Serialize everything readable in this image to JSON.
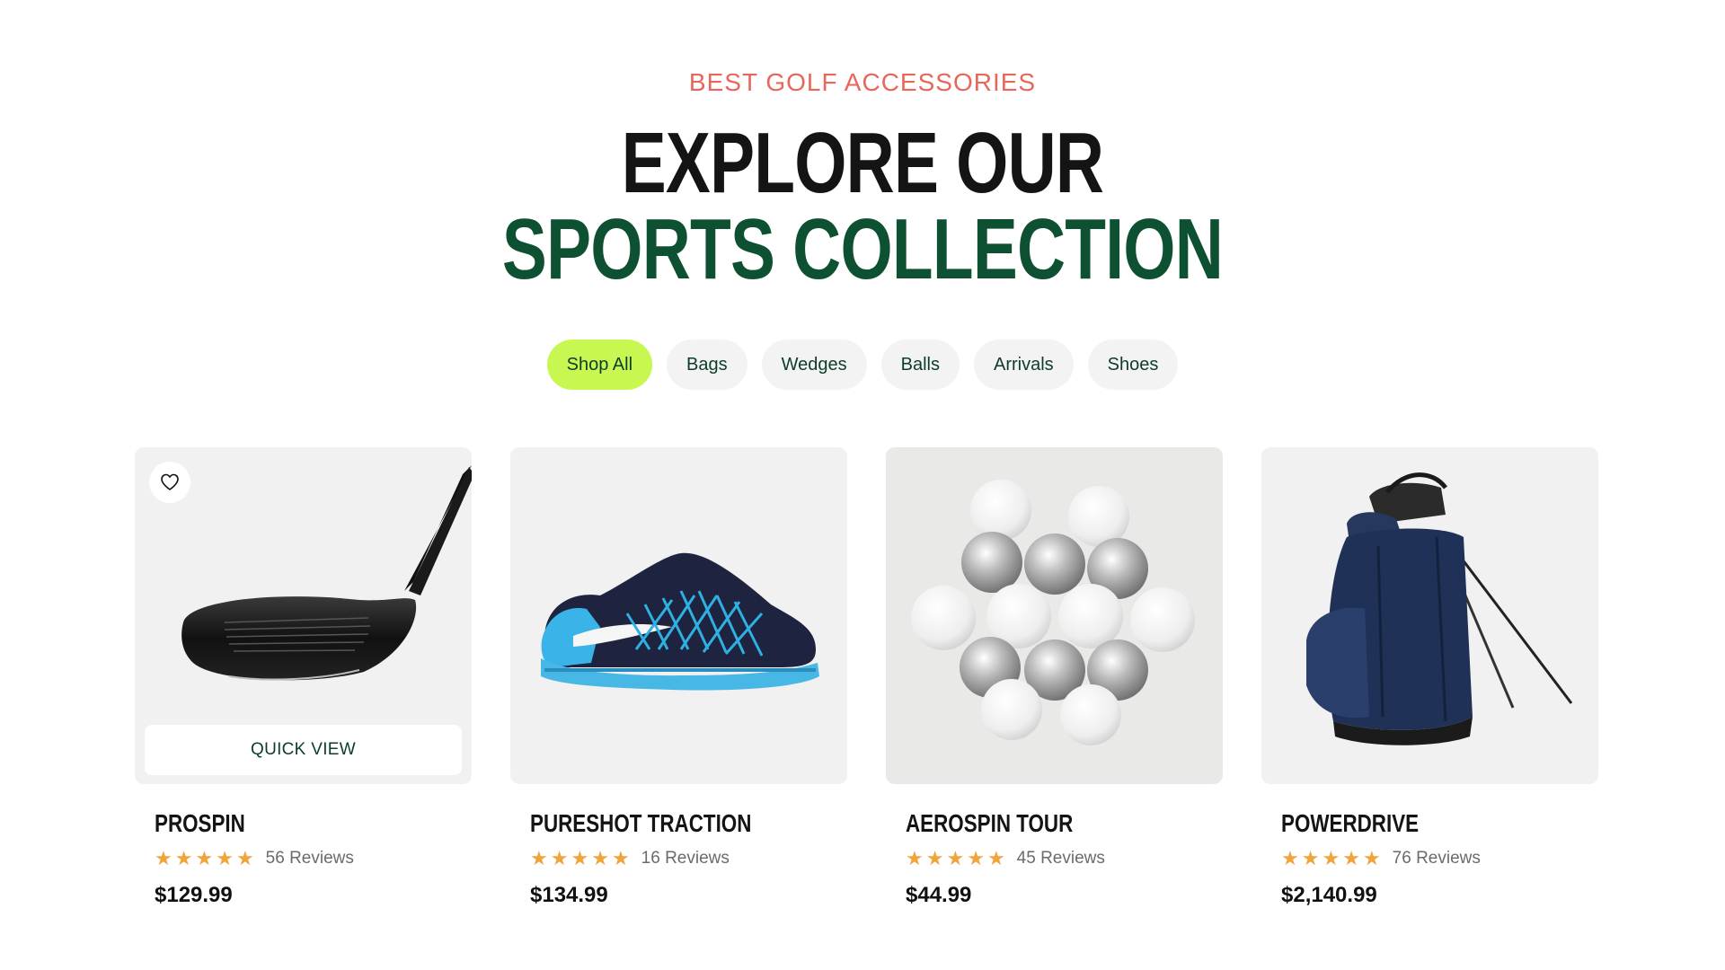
{
  "section": {
    "eyebrow": "BEST GOLF ACCESSORIES",
    "title_line1": "EXPLORE OUR",
    "title_line2": "SPORTS COLLECTION"
  },
  "filters": [
    {
      "label": "Shop All",
      "active": true
    },
    {
      "label": "Bags",
      "active": false
    },
    {
      "label": "Wedges",
      "active": false
    },
    {
      "label": "Balls",
      "active": false
    },
    {
      "label": "Arrivals",
      "active": false
    },
    {
      "label": "Shoes",
      "active": false
    }
  ],
  "products": [
    {
      "name": "PROSPIN",
      "rating": 5,
      "reviews": "56 Reviews",
      "price": "$129.99",
      "image": "golf-driver-club",
      "quick_view": "QUICK VIEW",
      "wishlist": "heart-icon"
    },
    {
      "name": "PURESHOT TRACTION",
      "rating": 5,
      "reviews": "16 Reviews",
      "price": "$134.99",
      "image": "sneaker-shoe"
    },
    {
      "name": "AEROSPIN TOUR",
      "rating": 5,
      "reviews": "45 Reviews",
      "price": "$44.99",
      "image": "golf-balls-cluster"
    },
    {
      "name": "POWERDRIVE",
      "rating": 5,
      "reviews": "76 Reviews",
      "price": "$2,140.99",
      "image": "golf-stand-bag"
    }
  ],
  "colors": {
    "accent_green": "#c8f752",
    "dark_green": "#0d5132",
    "eyebrow_coral": "#e8665a",
    "star_orange": "#f0a43c"
  }
}
